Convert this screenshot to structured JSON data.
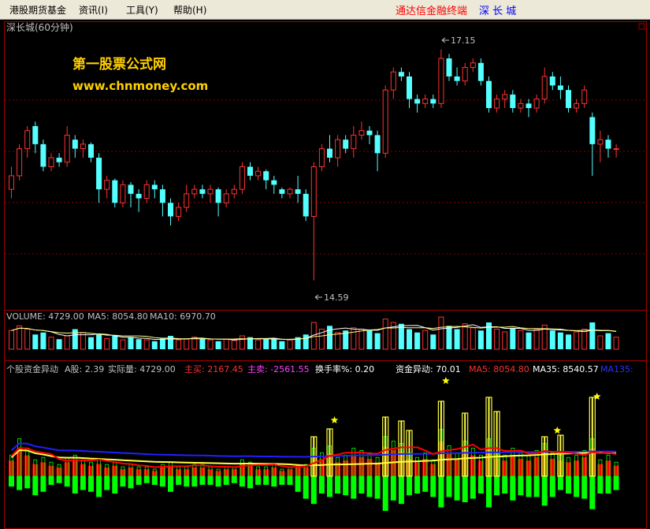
{
  "menu": {
    "items": [
      {
        "label": "港股期货基金"
      },
      {
        "label": "资讯(I)"
      },
      {
        "label": "工具(Y)"
      },
      {
        "label": "帮助(H)"
      }
    ],
    "app_name": "通达信金融终端",
    "stock_name": "深 长 城"
  },
  "price_panel": {
    "title": "深长城(60分钟)",
    "watermark_line1": "第一股票公式网",
    "watermark_line2": "www.chnmoney.com",
    "high_label": "17.15",
    "low_label": "14.59"
  },
  "volume_panel": {
    "label_volume": "VOLUME: 4729.00",
    "label_ma5": "MA5: 8054.80",
    "label_ma10": "MA10: 6970.70"
  },
  "indicator_panel": {
    "labels": [
      {
        "text": "个股资金异动",
        "color": "#c0c0c0"
      },
      {
        "text": "A股: 2.39",
        "color": "#c0c0c0"
      },
      {
        "text": "实际量: 4729.00",
        "color": "#c0c0c0"
      },
      {
        "text": "主买: 2167.45",
        "color": "#ff3030"
      },
      {
        "text": "主卖: -2561.55",
        "color": "#ff40ff"
      },
      {
        "text": "换手率%: 0.20",
        "color": "#ffffff"
      },
      {
        "text": "资金异动: 70.01",
        "color": "#ffffff"
      },
      {
        "text": "MA5: 8054.80",
        "color": "#ff3030"
      },
      {
        "text": "MA35: 8540.57",
        "color": "#ffffff"
      },
      {
        "text": "MA135:",
        "color": "#3030ff"
      }
    ]
  },
  "colors": {
    "up": "#ff3232",
    "down": "#54ffff",
    "grid": "#8b0000",
    "green_bar": "#00ff00",
    "red_bar": "#ff0000",
    "yellow": "#ffff40",
    "star": "#ffff00",
    "blue_line": "#2020ff",
    "watermark": "#ffd000",
    "menu_red": "#ff0000",
    "menu_blue": "#0000ff"
  },
  "chart_data": {
    "type": "candlestick",
    "price_high": 17.15,
    "price_low": 14.59,
    "price_range": [
      14.3,
      17.4
    ],
    "candles": [
      [
        15.6,
        15.75,
        15.85,
        15.5
      ],
      [
        15.75,
        16.05,
        16.1,
        15.7
      ],
      [
        16.05,
        16.25,
        16.3,
        15.95
      ],
      [
        16.3,
        16.1,
        16.35,
        16.0
      ],
      [
        16.1,
        15.85,
        16.15,
        15.8
      ],
      [
        15.85,
        15.95,
        16.0,
        15.8
      ],
      [
        15.95,
        15.9,
        16.0,
        15.85
      ],
      [
        15.9,
        16.2,
        16.3,
        15.85
      ],
      [
        16.15,
        16.05,
        16.2,
        15.95
      ],
      [
        16.05,
        16.1,
        16.15,
        15.95
      ],
      [
        16.1,
        15.95,
        16.12,
        15.9
      ],
      [
        15.95,
        15.6,
        16.0,
        15.45
      ],
      [
        15.6,
        15.7,
        15.75,
        15.5
      ],
      [
        15.7,
        15.45,
        15.72,
        15.4
      ],
      [
        15.45,
        15.65,
        15.7,
        15.4
      ],
      [
        15.65,
        15.55,
        15.68,
        15.4
      ],
      [
        15.55,
        15.5,
        15.6,
        15.35
      ],
      [
        15.5,
        15.65,
        15.7,
        15.45
      ],
      [
        15.65,
        15.6,
        15.7,
        15.5
      ],
      [
        15.6,
        15.45,
        15.65,
        15.3
      ],
      [
        15.45,
        15.3,
        15.5,
        15.2
      ],
      [
        15.3,
        15.4,
        15.45,
        15.25
      ],
      [
        15.4,
        15.55,
        15.65,
        15.35
      ],
      [
        15.55,
        15.6,
        15.65,
        15.5
      ],
      [
        15.6,
        15.55,
        15.65,
        15.5
      ],
      [
        15.55,
        15.6,
        15.65,
        15.45
      ],
      [
        15.6,
        15.45,
        15.62,
        15.3
      ],
      [
        15.45,
        15.55,
        15.6,
        15.4
      ],
      [
        15.55,
        15.6,
        15.65,
        15.5
      ],
      [
        15.6,
        15.85,
        15.9,
        15.55
      ],
      [
        15.85,
        15.75,
        15.9,
        15.7
      ],
      [
        15.75,
        15.8,
        15.85,
        15.7
      ],
      [
        15.8,
        15.7,
        15.82,
        15.6
      ],
      [
        15.7,
        15.65,
        15.75,
        15.55
      ],
      [
        15.6,
        15.55,
        15.62,
        15.5
      ],
      [
        15.55,
        15.6,
        15.62,
        15.5
      ],
      [
        15.6,
        15.55,
        15.75,
        15.45
      ],
      [
        15.55,
        15.3,
        15.6,
        15.25
      ],
      [
        15.3,
        15.85,
        15.9,
        14.59
      ],
      [
        15.85,
        16.05,
        16.1,
        15.8
      ],
      [
        16.05,
        15.95,
        16.2,
        15.9
      ],
      [
        15.95,
        16.15,
        16.2,
        15.85
      ],
      [
        16.15,
        16.05,
        16.2,
        16.0
      ],
      [
        16.05,
        16.2,
        16.3,
        15.95
      ],
      [
        16.2,
        16.25,
        16.35,
        16.15
      ],
      [
        16.25,
        16.2,
        16.3,
        16.1
      ],
      [
        16.2,
        16.0,
        16.25,
        15.8
      ],
      [
        16.0,
        16.7,
        16.75,
        15.95
      ],
      [
        16.7,
        16.9,
        16.95,
        16.6
      ],
      [
        16.9,
        16.85,
        16.95,
        16.8
      ],
      [
        16.85,
        16.6,
        16.9,
        16.5
      ],
      [
        16.6,
        16.55,
        16.65,
        16.45
      ],
      [
        16.55,
        16.6,
        16.65,
        16.5
      ],
      [
        16.6,
        16.55,
        16.65,
        16.5
      ],
      [
        16.55,
        17.05,
        17.15,
        16.5
      ],
      [
        17.05,
        16.85,
        17.1,
        16.8
      ],
      [
        16.85,
        16.8,
        16.95,
        16.75
      ],
      [
        16.8,
        16.95,
        17.0,
        16.75
      ],
      [
        16.95,
        17.0,
        17.05,
        16.9
      ],
      [
        17.0,
        16.8,
        17.05,
        16.75
      ],
      [
        16.8,
        16.5,
        16.85,
        16.45
      ],
      [
        16.5,
        16.6,
        16.65,
        16.45
      ],
      [
        16.6,
        16.65,
        16.7,
        16.5
      ],
      [
        16.65,
        16.5,
        16.7,
        16.45
      ],
      [
        16.5,
        16.55,
        16.6,
        16.45
      ],
      [
        16.55,
        16.5,
        16.6,
        16.4
      ],
      [
        16.5,
        16.6,
        16.65,
        16.45
      ],
      [
        16.6,
        16.85,
        16.95,
        16.55
      ],
      [
        16.85,
        16.75,
        16.9,
        16.7
      ],
      [
        16.75,
        16.7,
        16.85,
        16.6
      ],
      [
        16.7,
        16.5,
        16.75,
        16.45
      ],
      [
        16.5,
        16.55,
        16.6,
        16.45
      ],
      [
        16.55,
        16.7,
        16.75,
        16.5
      ],
      [
        16.4,
        16.1,
        16.45,
        15.75
      ],
      [
        16.1,
        16.15,
        16.25,
        15.9
      ],
      [
        16.15,
        16.05,
        16.2,
        15.95
      ],
      [
        16.05,
        16.05,
        16.1,
        15.95
      ]
    ],
    "volume": [
      28,
      35,
      30,
      22,
      25,
      18,
      15,
      20,
      30,
      25,
      18,
      22,
      16,
      20,
      14,
      18,
      15,
      14,
      12,
      16,
      20,
      14,
      15,
      18,
      16,
      14,
      12,
      15,
      13,
      20,
      18,
      14,
      15,
      16,
      12,
      14,
      18,
      22,
      40,
      30,
      35,
      25,
      28,
      32,
      30,
      28,
      24,
      45,
      40,
      38,
      30,
      25,
      28,
      22,
      48,
      35,
      30,
      38,
      32,
      28,
      40,
      30,
      26,
      32,
      28,
      25,
      30,
      36,
      28,
      25,
      22,
      26,
      30,
      40,
      20,
      24,
      18
    ],
    "flow": [
      [
        0.9,
        0.6
      ],
      [
        1.6,
        0.8
      ],
      [
        1.2,
        0.7
      ],
      [
        0.7,
        1.1
      ],
      [
        0.8,
        0.9
      ],
      [
        0.6,
        0.5
      ],
      [
        0.5,
        0.4
      ],
      [
        0.8,
        0.6
      ],
      [
        0.9,
        1.0
      ],
      [
        0.7,
        0.8
      ],
      [
        0.6,
        0.9
      ],
      [
        0.7,
        1.2
      ],
      [
        0.5,
        0.8
      ],
      [
        0.6,
        1.0
      ],
      [
        0.4,
        0.6
      ],
      [
        0.5,
        0.7
      ],
      [
        0.4,
        0.5
      ],
      [
        0.4,
        0.4
      ],
      [
        0.3,
        0.5
      ],
      [
        0.5,
        0.6
      ],
      [
        0.6,
        0.9
      ],
      [
        0.4,
        0.5
      ],
      [
        0.4,
        0.6
      ],
      [
        0.5,
        0.6
      ],
      [
        0.5,
        0.5
      ],
      [
        0.4,
        0.5
      ],
      [
        0.3,
        0.6
      ],
      [
        0.4,
        0.5
      ],
      [
        0.4,
        0.4
      ],
      [
        0.7,
        0.6
      ],
      [
        0.6,
        0.7
      ],
      [
        0.4,
        0.5
      ],
      [
        0.4,
        0.5
      ],
      [
        0.5,
        0.6
      ],
      [
        0.3,
        0.5
      ],
      [
        0.4,
        0.5
      ],
      [
        0.5,
        0.9
      ],
      [
        0.5,
        1.3
      ],
      [
        1.2,
        1.6
      ],
      [
        1.0,
        1.0
      ],
      [
        1.3,
        1.2
      ],
      [
        0.8,
        1.0
      ],
      [
        0.9,
        1.1
      ],
      [
        1.2,
        1.3
      ],
      [
        1.1,
        1.0
      ],
      [
        1.0,
        1.2
      ],
      [
        0.8,
        1.3
      ],
      [
        1.7,
        2.0
      ],
      [
        1.5,
        1.4
      ],
      [
        1.4,
        1.6
      ],
      [
        1.0,
        1.1
      ],
      [
        0.8,
        1.0
      ],
      [
        1.0,
        0.9
      ],
      [
        0.7,
        1.2
      ],
      [
        2.0,
        1.8
      ],
      [
        1.3,
        1.2
      ],
      [
        1.0,
        1.4
      ],
      [
        1.5,
        1.5
      ],
      [
        1.2,
        1.3
      ],
      [
        0.9,
        1.0
      ],
      [
        1.6,
        1.8
      ],
      [
        1.0,
        1.1
      ],
      [
        0.9,
        1.0
      ],
      [
        1.2,
        1.4
      ],
      [
        1.0,
        1.1
      ],
      [
        0.9,
        1.2
      ],
      [
        1.1,
        1.2
      ],
      [
        1.4,
        1.7
      ],
      [
        1.0,
        1.2
      ],
      [
        0.9,
        0.8
      ],
      [
        0.8,
        1.0
      ],
      [
        0.9,
        1.2
      ],
      [
        1.1,
        1.3
      ],
      [
        1.6,
        1.9
      ],
      [
        0.7,
        1.0
      ],
      [
        0.9,
        1.0
      ],
      [
        0.6,
        0.8
      ]
    ],
    "yellow_bars": [
      [
        38,
        50
      ],
      [
        40,
        60
      ],
      [
        47,
        75
      ],
      [
        49,
        70
      ],
      [
        50,
        58
      ],
      [
        54,
        95
      ],
      [
        57,
        80
      ],
      [
        60,
        100
      ],
      [
        61,
        82
      ],
      [
        67,
        50
      ],
      [
        69,
        52
      ],
      [
        73,
        100
      ]
    ],
    "stars": [
      [
        40,
        65
      ],
      [
        54,
        115
      ],
      [
        68,
        52
      ],
      [
        73,
        95
      ]
    ]
  }
}
